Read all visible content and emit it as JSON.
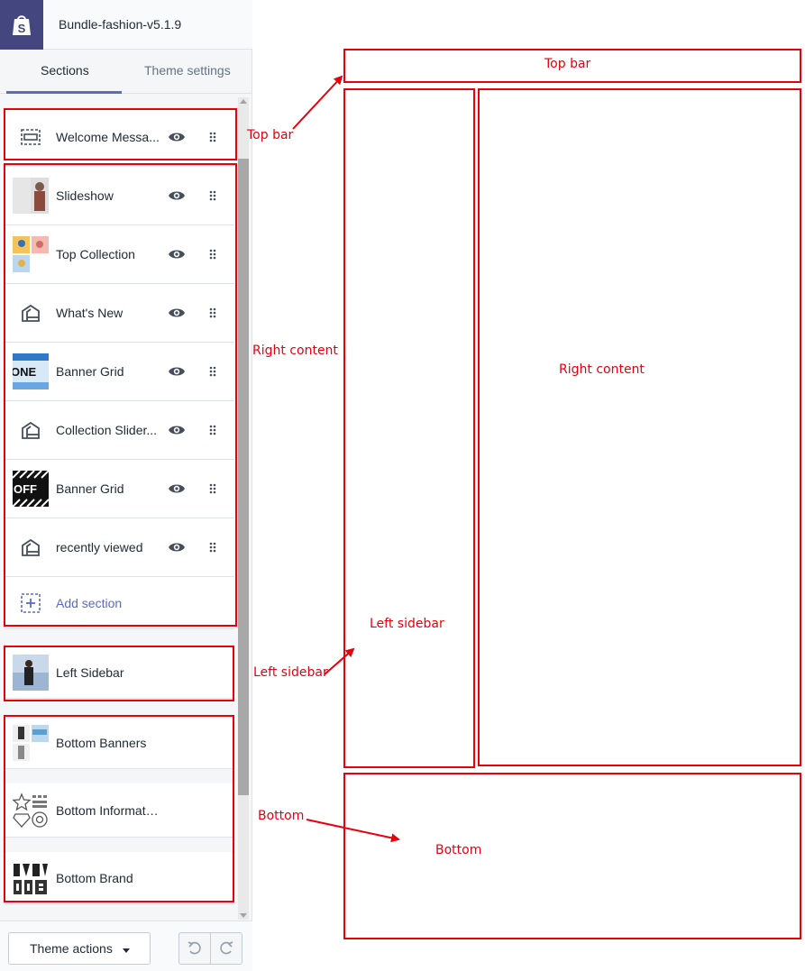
{
  "app": {
    "title": "Bundle-fashion-v5.1.9",
    "logo_icon": "shopify-bag-icon"
  },
  "tabs": [
    {
      "label": "Sections",
      "active": true
    },
    {
      "label": "Theme settings",
      "active": false
    }
  ],
  "sections": [
    {
      "label": "Welcome Messa...",
      "icon": "header-layout-icon"
    },
    {
      "label": "Slideshow",
      "icon": "image-thumbnail"
    },
    {
      "label": "Top Collection",
      "icon": "image-thumbnail"
    },
    {
      "label": "What's New",
      "icon": "section-house-icon"
    },
    {
      "label": "Banner Grid",
      "icon": "image-thumbnail"
    },
    {
      "label": "Collection Slider...",
      "icon": "section-house-icon"
    },
    {
      "label": "Banner Grid",
      "icon": "image-thumbnail"
    },
    {
      "label": "recently viewed",
      "icon": "section-house-icon"
    },
    {
      "label": "Add section",
      "icon": "add-section-icon"
    },
    {
      "label": "Left Sidebar",
      "icon": "image-thumbnail"
    },
    {
      "label": "Bottom Banners",
      "icon": "image-thumbnail"
    },
    {
      "label": "Bottom Information",
      "icon": "image-thumbnail"
    },
    {
      "label": "Bottom Brand",
      "icon": "image-thumbnail"
    }
  ],
  "thumb_text": {
    "one": "ONE",
    "off": "OFF"
  },
  "footer": {
    "theme_actions": "Theme actions",
    "undo_icon": "undo-icon",
    "redo_icon": "redo-icon"
  },
  "annotations": {
    "top_bar_side": "Top bar",
    "top_bar_box": "Top bar",
    "right_content_side": "Right content",
    "right_content_box": "Right content",
    "left_sidebar_box": "Left sidebar",
    "left_sidebar_side": "Left sidebar",
    "bottom_side": "Bottom",
    "bottom_box": "Bottom"
  },
  "colors": {
    "annotation": "#e8000b",
    "accent": "#5c6ac4",
    "logo_bg": "#43467f"
  }
}
